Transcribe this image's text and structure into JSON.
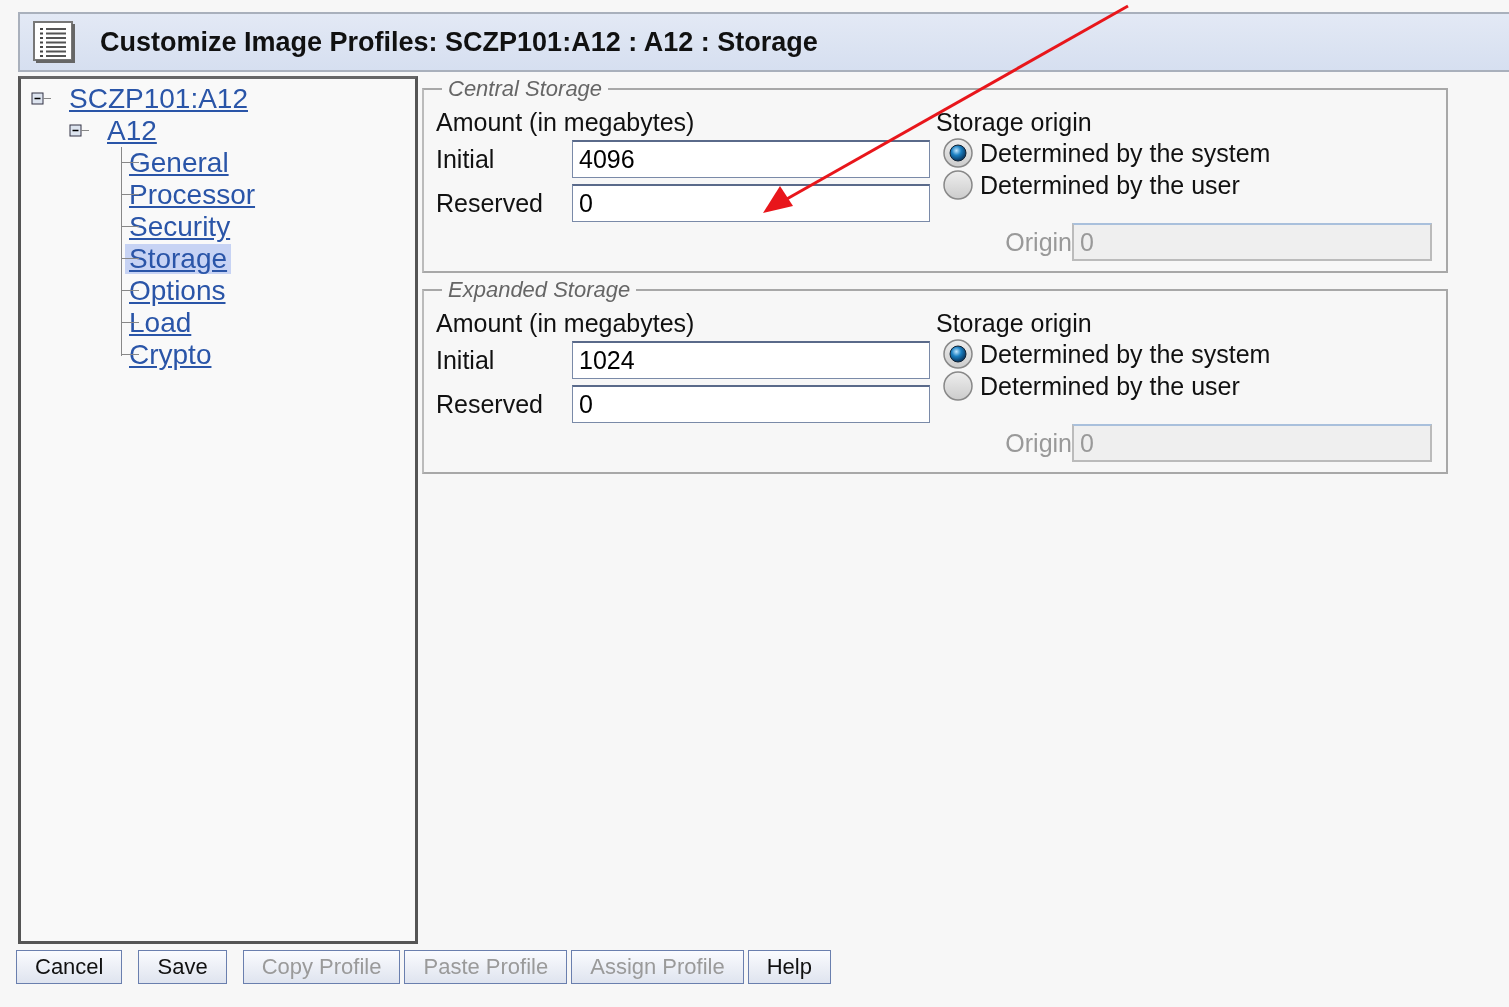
{
  "window": {
    "title": "Customize Image Profiles: SCZP101:A12 : A12 : Storage"
  },
  "tree": {
    "label": "SCZP101:A12",
    "expanded": true,
    "children": [
      {
        "label": "A12",
        "expanded": true,
        "children": [
          {
            "label": "General",
            "selected": false
          },
          {
            "label": "Processor",
            "selected": false
          },
          {
            "label": "Security",
            "selected": false
          },
          {
            "label": "Storage",
            "selected": true
          },
          {
            "label": "Options",
            "selected": false
          },
          {
            "label": "Load",
            "selected": false
          },
          {
            "label": "Crypto",
            "selected": false
          }
        ]
      }
    ]
  },
  "groups": [
    {
      "title": "Central Storage",
      "amount_label": "Amount (in megabytes)",
      "initial_label": "Initial",
      "initial": "4096",
      "reserved_label": "Reserved",
      "reserved": "0",
      "origin_heading": "Storage origin",
      "options": [
        {
          "label": "Determined by the system",
          "selected": true
        },
        {
          "label": "Determined by the user",
          "selected": false
        }
      ],
      "origin_label": "Origin",
      "origin": "0",
      "origin_disabled": true
    },
    {
      "title": "Expanded Storage",
      "amount_label": "Amount (in megabytes)",
      "initial_label": "Initial",
      "initial": "1024",
      "reserved_label": "Reserved",
      "reserved": "0",
      "origin_heading": "Storage origin",
      "options": [
        {
          "label": "Determined by the system",
          "selected": true
        },
        {
          "label": "Determined by the user",
          "selected": false
        }
      ],
      "origin_label": "Origin",
      "origin": "0",
      "origin_disabled": true
    }
  ],
  "buttons": [
    {
      "label": "Cancel",
      "disabled": false
    },
    {
      "label": "Save",
      "disabled": false
    },
    {
      "label": "Copy Profile",
      "disabled": true
    },
    {
      "label": "Paste Profile",
      "disabled": true
    },
    {
      "label": "Assign Profile",
      "disabled": true
    },
    {
      "label": "Help",
      "disabled": false
    }
  ],
  "annotation": {
    "kind": "arrow"
  }
}
